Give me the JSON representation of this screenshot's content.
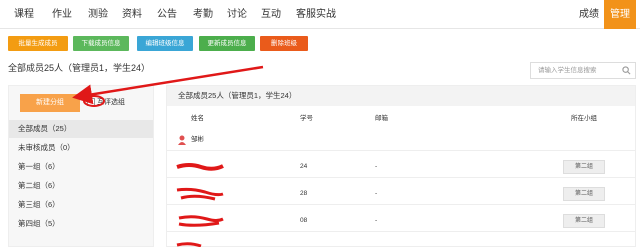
{
  "nav": {
    "items": [
      "课程",
      "作业",
      "测验",
      "资料",
      "公告",
      "考勤",
      "讨论",
      "互动",
      "客服实战"
    ],
    "grades": "成绩",
    "manage": "管理"
  },
  "actions": {
    "batch_generate": "批量生成成员",
    "download_members": "下载成员信息",
    "edit_class": "编辑班级信息",
    "update_members": "更新成员信息",
    "delete_class": "删除班级"
  },
  "summary": "全部成员25人（管理员1，学生24）",
  "search": {
    "placeholder": "请输入学生信息搜索"
  },
  "left": {
    "new_group": "新建分组",
    "mutual_review": "互评选组",
    "groups": [
      "全部成员（25）",
      "未审核成员（0）",
      "第一组（6）",
      "第二组（6）",
      "第三组（6）",
      "第四组（5）"
    ]
  },
  "table": {
    "header": "全部成员25人（管理员1，学生24）",
    "columns": {
      "name": "姓名",
      "id": "学号",
      "email": "邮箱",
      "group": "所在小组"
    },
    "rows": [
      {
        "name": "邹彬",
        "id": "",
        "email": "",
        "group": ""
      },
      {
        "name": "",
        "id": "24",
        "email": "-",
        "group": "第二组"
      },
      {
        "name": "",
        "id": "28",
        "email": "-",
        "group": "第二组"
      },
      {
        "name": "",
        "id": "08",
        "email": "-",
        "group": "第二组"
      }
    ]
  },
  "colors": {
    "accent": "#f29219",
    "annotation": "#e01818",
    "btn_orange": "#f39c12",
    "btn_green": "#5cb85c",
    "btn_blue": "#3aa6d6",
    "btn_green2": "#4cae4c",
    "btn_red": "#ea5b1b"
  }
}
